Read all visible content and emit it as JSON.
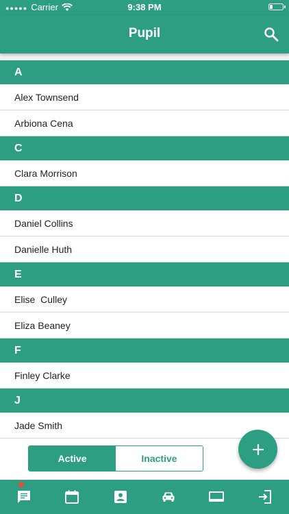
{
  "status_bar": {
    "carrier": "Carrier",
    "time": "9:38 PM"
  },
  "header": {
    "title": "Pupil"
  },
  "sections": [
    {
      "letter": "A",
      "pupils": [
        "Alex Townsend",
        "Arbiona Cena"
      ]
    },
    {
      "letter": "C",
      "pupils": [
        "Clara Morrison"
      ]
    },
    {
      "letter": "D",
      "pupils": [
        "Daniel Collins",
        "Danielle Huth"
      ]
    },
    {
      "letter": "E",
      "pupils": [
        "Elise  Culley",
        "Eliza Beaney"
      ]
    },
    {
      "letter": "F",
      "pupils": [
        "Finley Clarke"
      ]
    },
    {
      "letter": "J",
      "pupils": [
        "Jade Smith"
      ]
    }
  ],
  "filter": {
    "active_label": "Active",
    "inactive_label": "Inactive",
    "selected": "Active"
  },
  "tabs": [
    "messages-icon",
    "calendar-icon",
    "contact-card-icon",
    "car-icon",
    "display-icon",
    "logout-icon"
  ],
  "colors": {
    "primary": "#2e9e83",
    "badge": "#e84a3c",
    "separator": "#d6d6d6"
  }
}
